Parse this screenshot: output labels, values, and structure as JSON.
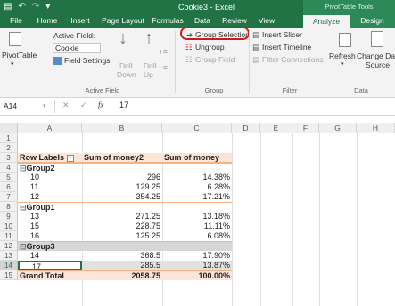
{
  "window": {
    "title": "Cookie3 - Excel",
    "context_tools": "PivotTable Tools"
  },
  "tabs": [
    "File",
    "Home",
    "Insert",
    "Page Layout",
    "Formulas",
    "Data",
    "Review",
    "View",
    "Analyze",
    "Design"
  ],
  "active_tab": "Analyze",
  "ribbon": {
    "active_field": {
      "label": "Active Field:",
      "value": "Cookie",
      "field_settings": "Field Settings",
      "pivottable": "PivotTable",
      "drill_down_1": "Drill",
      "drill_down_2": "Down",
      "drill_up_1": "Drill",
      "drill_up_2": "Up",
      "group_label": "Active Field"
    },
    "group": {
      "group_selection": "Group Selection",
      "ungroup": "Ungroup",
      "group_field": "Group Field",
      "group_label": "Group"
    },
    "filter": {
      "insert_slicer": "Insert Slicer",
      "insert_timeline": "Insert Timeline",
      "filter_connections": "Filter Connections",
      "group_label": "Filter"
    },
    "data": {
      "refresh": "Refresh",
      "change_data_1": "Change Data",
      "change_data_2": "Source",
      "group_label": "Data"
    }
  },
  "formula_bar": {
    "name_box": "A14",
    "fx": "fx",
    "value": "17"
  },
  "columns": [
    "A",
    "B",
    "C",
    "D",
    "E",
    "F",
    "G",
    "H"
  ],
  "rows": [
    "1",
    "2",
    "3",
    "4",
    "5",
    "6",
    "7",
    "8",
    "9",
    "10",
    "11",
    "12",
    "13",
    "14",
    "15"
  ],
  "pivot": {
    "headers": [
      "Row Labels",
      "Sum of money2",
      "Sum of money"
    ],
    "groups": [
      {
        "name": "Group2",
        "items": [
          {
            "label": "10",
            "money2": "296",
            "money": "14.38%"
          },
          {
            "label": "11",
            "money2": "129.25",
            "money": "6.28%"
          },
          {
            "label": "12",
            "money2": "354.25",
            "money": "17.21%"
          }
        ]
      },
      {
        "name": "Group1",
        "items": [
          {
            "label": "13",
            "money2": "271.25",
            "money": "13.18%"
          },
          {
            "label": "15",
            "money2": "228.75",
            "money": "11.11%"
          },
          {
            "label": "16",
            "money2": "125.25",
            "money": "6.08%"
          }
        ]
      },
      {
        "name": "Group3",
        "items": [
          {
            "label": "14",
            "money2": "368.5",
            "money": "17.90%"
          },
          {
            "label": "17",
            "money2": "285.5",
            "money": "13.87%"
          }
        ]
      }
    ],
    "total": {
      "label": "Grand Total",
      "money2": "2058.75",
      "money": "100.00%"
    }
  },
  "colors": {
    "excel_green": "#217346",
    "pivot_header": "#fce4d6",
    "highlight": "#d0171d"
  }
}
